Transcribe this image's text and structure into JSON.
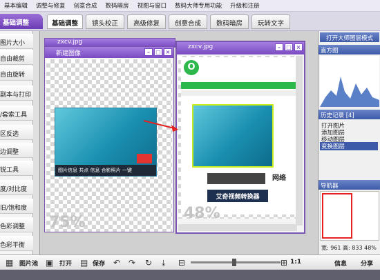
{
  "menubar": [
    "基本编辑",
    "调整与修复",
    "创意合成",
    "数码暗房",
    "视图与窗口",
    "数码大师专用功能",
    "升级和注册"
  ],
  "left_tab": "基础调整",
  "tabs": [
    {
      "label": "基础调整",
      "active": true
    },
    {
      "label": "镜头校正",
      "active": false
    },
    {
      "label": "高级修复",
      "active": false
    },
    {
      "label": "创意合成",
      "active": false
    },
    {
      "label": "数码暗房",
      "active": false
    },
    {
      "label": "玩转文字",
      "active": false
    }
  ],
  "tools": [
    "图片大小",
    "自由裁剪",
    "自由旋转",
    "副本与打印",
    "/套索工具",
    "区反选",
    "边调整",
    "锐工具",
    "度/对比度",
    "旧/饱和度",
    "色彩调整",
    "色彩平衡"
  ],
  "window1": {
    "title": "新建图像",
    "zoom": "75%"
  },
  "window2": {
    "title": "zxcv.jpg",
    "zoom": "48%",
    "banner_logo": "艾奇视频转换器"
  },
  "window0": {
    "title": "zxcv.jpg"
  },
  "image_caption": "图片信息 共点 信息 合影照片 一键",
  "web_text": {
    "tagline": "艾奇视频转换器",
    "side": "网络"
  },
  "right_panel": {
    "mode_button": "打开大师图层模式",
    "histogram_label": "直方图",
    "history_label": "历史记录 [4]",
    "history_items": [
      "打开图片",
      "添加图层",
      "移动图层",
      "变换图层"
    ],
    "history_selected": 3,
    "navigator_label": "导航器",
    "size_text": "宽: 961 高: 833 48%"
  },
  "bottom": {
    "pool": "图片池",
    "open": "打开",
    "save": "保存",
    "ratio": "1:1",
    "info": "信息",
    "share": "分享"
  },
  "colors": {
    "accent": "#7a4bc2",
    "selected": "#3d5aa8",
    "handle": "#c8f020",
    "arrow": "#e52121"
  }
}
